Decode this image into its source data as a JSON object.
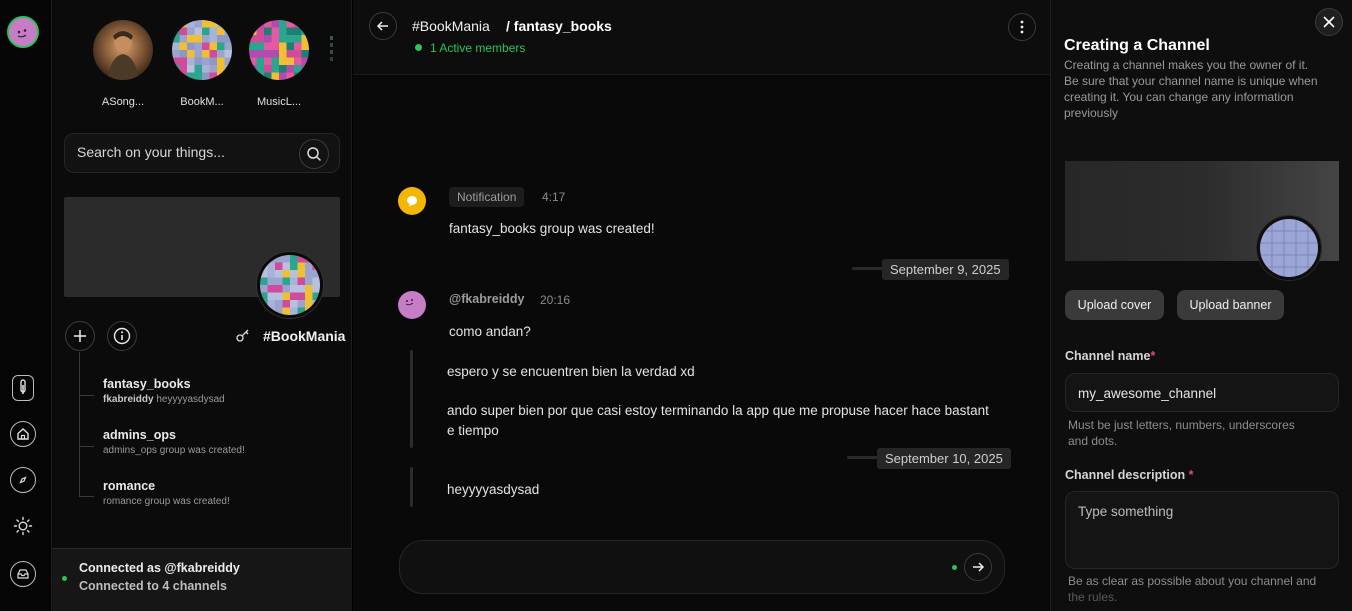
{
  "colors": {
    "accent_green": "#2ec25a",
    "user_avatar": "#c77dc6",
    "notification": "#f2b705",
    "required": "#e0457b"
  },
  "rail": {
    "icons": [
      "user-avatar",
      "thermometer-icon",
      "home-icon",
      "compass-icon",
      "sun-icon",
      "inbox-icon"
    ]
  },
  "stories": [
    {
      "label": "ASong..."
    },
    {
      "label": "BookM..."
    },
    {
      "label": "MusicL..."
    }
  ],
  "search": {
    "placeholder": "Search on your things..."
  },
  "group": {
    "name": "#BookMania"
  },
  "channels": [
    {
      "name": "fantasy_books",
      "user": "fkabreiddy",
      "preview": " heyyyyasdysad"
    },
    {
      "name": "admins_ops",
      "user": "",
      "preview": "admins_ops group was created!"
    },
    {
      "name": "romance",
      "user": "",
      "preview": "romance group was created!"
    }
  ],
  "status": {
    "line1": "Connected as @fkabreiddy",
    "line2": "Connected to 4 channels"
  },
  "chat": {
    "group": "#BookMania",
    "channel": "/ fantasy_books",
    "active": "1 Active members",
    "notification": {
      "tag": "Notification",
      "time": "4:17",
      "text": "fantasy_books group was created!"
    },
    "date1": "September 9, 2025",
    "message": {
      "user": "@fkabreiddy",
      "time": "20:16",
      "text": "como andan?",
      "followups": [
        "espero y se encuentren bien la verdad xd",
        "ando super bien por que casi estoy terminando la app que me propuse hacer hace bastant",
        "e tiempo"
      ]
    },
    "date2": "September 10, 2025",
    "last": "heyyyyasdysad"
  },
  "panel": {
    "title": "Creating a Channel",
    "desc1": "Creating a channel makes you the owner of it.",
    "desc2": "Be sure that your channel name is unique when",
    "desc3": "creating it. You can change any information",
    "desc4": "previously",
    "upload_cover": "Upload cover",
    "upload_banner": "Upload banner",
    "name_label": "Channel name",
    "name_value": "my_awesome_channel",
    "name_hint1": "Must be just letters, numbers, underscores",
    "name_hint2": "and dots.",
    "desc_label": "Channel description",
    "desc_placeholder": "Type something",
    "desc_hint1": "Be as clear as possible about you channel and",
    "desc_hint2": "the rules.",
    "required_mark": "*"
  }
}
